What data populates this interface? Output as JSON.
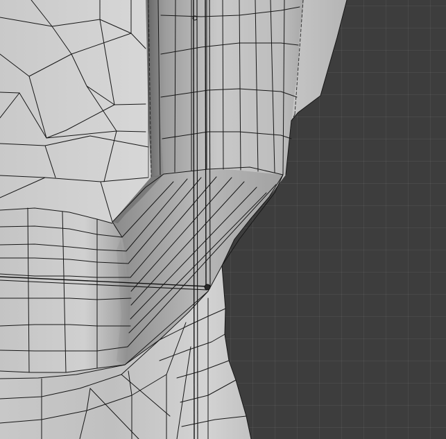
{
  "viewport": {
    "background_color": "#3d3d3d",
    "grid_color": "#4a4a4a",
    "mesh_color": "#bcbcbc",
    "mesh_shadow_color": "#7a7a7a",
    "wire_color": "#161616"
  },
  "scene": {
    "mesh": "mesh-model",
    "icons": [
      "bone-icon",
      "empty-object-icon"
    ]
  }
}
